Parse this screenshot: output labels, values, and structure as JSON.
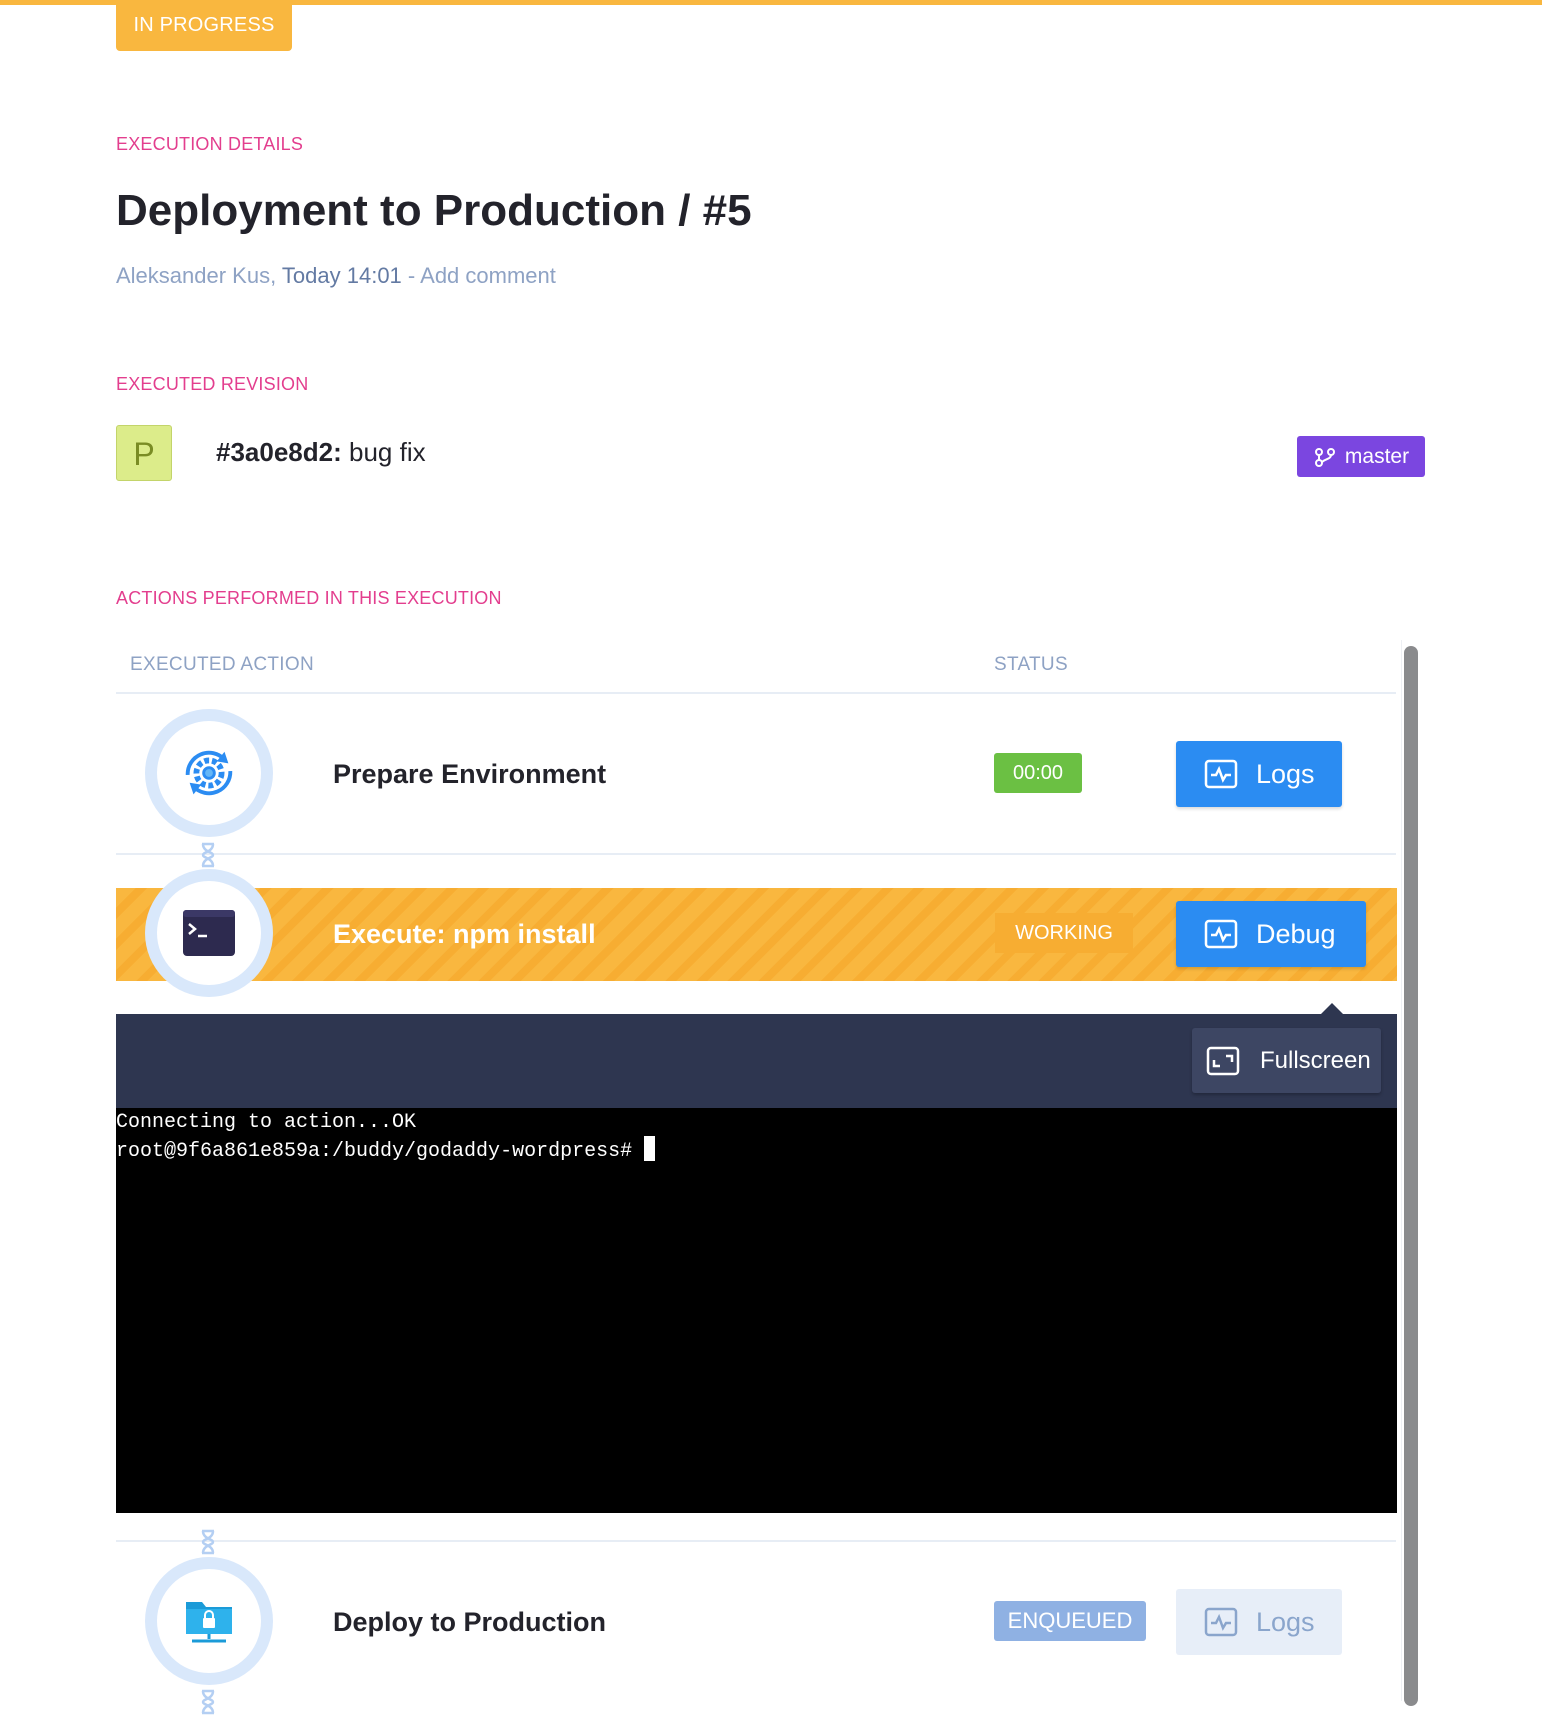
{
  "status_pill": "IN PROGRESS",
  "execution_details": {
    "label": "EXECUTION DETAILS",
    "title": "Deployment to Production / #5",
    "author": "Aleksander Kus",
    "time": "Today 14:01",
    "separator": " - ",
    "add_comment": "Add comment"
  },
  "revision": {
    "label": "EXECUTED REVISION",
    "avatar_letter": "P",
    "hash": "#3a0e8d2:",
    "message": "bug fix",
    "branch": "master"
  },
  "actions": {
    "label": "ACTIONS PERFORMED IN THIS EXECUTION",
    "columns": {
      "action": "EXECUTED ACTION",
      "status": "STATUS"
    },
    "items": [
      {
        "name": "Prepare Environment",
        "status": "00:00",
        "button": "Logs",
        "icon": "gear-sync-icon"
      },
      {
        "name": "Execute: npm install",
        "status": "WORKING",
        "button": "Debug",
        "icon": "terminal-window-icon"
      },
      {
        "name": "Deploy to Production",
        "status": "ENQUEUED",
        "button": "Logs",
        "icon": "secure-folder-icon"
      }
    ]
  },
  "terminal": {
    "fullscreen_label": "Fullscreen",
    "lines": [
      "Connecting to action...OK",
      "root@9f6a861e859a:/buddy/godaddy-wordpress#"
    ]
  },
  "colors": {
    "accent_orange": "#f9b73f",
    "section_pink": "#e33e8e",
    "primary_blue": "#2b8cf2",
    "success_green": "#6bc043",
    "branch_purple": "#7b46e0",
    "enqueued_blue": "#8fb1e3"
  }
}
